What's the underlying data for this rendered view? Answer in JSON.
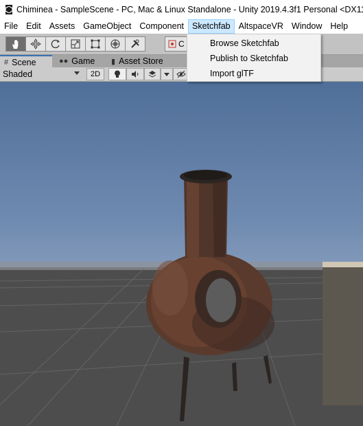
{
  "window": {
    "title": "Chiminea - SampleScene - PC, Mac & Linux Standalone - Unity 2019.4.3f1 Personal <DX11>",
    "app_icon": "unity-icon"
  },
  "menubar": {
    "items": [
      "File",
      "Edit",
      "Assets",
      "GameObject",
      "Component",
      "Sketchfab",
      "AltspaceVR",
      "Window",
      "Help"
    ],
    "active": "Sketchfab"
  },
  "sketchfab_menu": {
    "items": [
      "Browse Sketchfab",
      "Publish to Sketchfab",
      "Import glTF"
    ]
  },
  "toolbar": {
    "tools": [
      "hand-tool-icon",
      "move-tool-icon",
      "rotate-tool-icon",
      "scale-tool-icon",
      "rect-tool-icon",
      "transform-tool-icon",
      "custom-tool-icon"
    ],
    "selected_tool": "hand-tool-icon",
    "pivot_label": "C"
  },
  "tabs": [
    {
      "label": "Scene",
      "icon": "grid-icon",
      "active": true
    },
    {
      "label": "Game",
      "icon": "gamepad-icon",
      "active": false
    },
    {
      "label": "Asset Store",
      "icon": "bag-icon",
      "active": false
    }
  ],
  "scene_toolbar": {
    "shading_mode": "Shaded",
    "mode_2d_label": "2D"
  },
  "colors": {
    "menu_highlight": "#cce8ff",
    "toolbar_bg": "#c2c2c2",
    "tab_accent": "#3a72b0",
    "sky_top": "#4f6f99",
    "ground": "#4d4d4d"
  }
}
